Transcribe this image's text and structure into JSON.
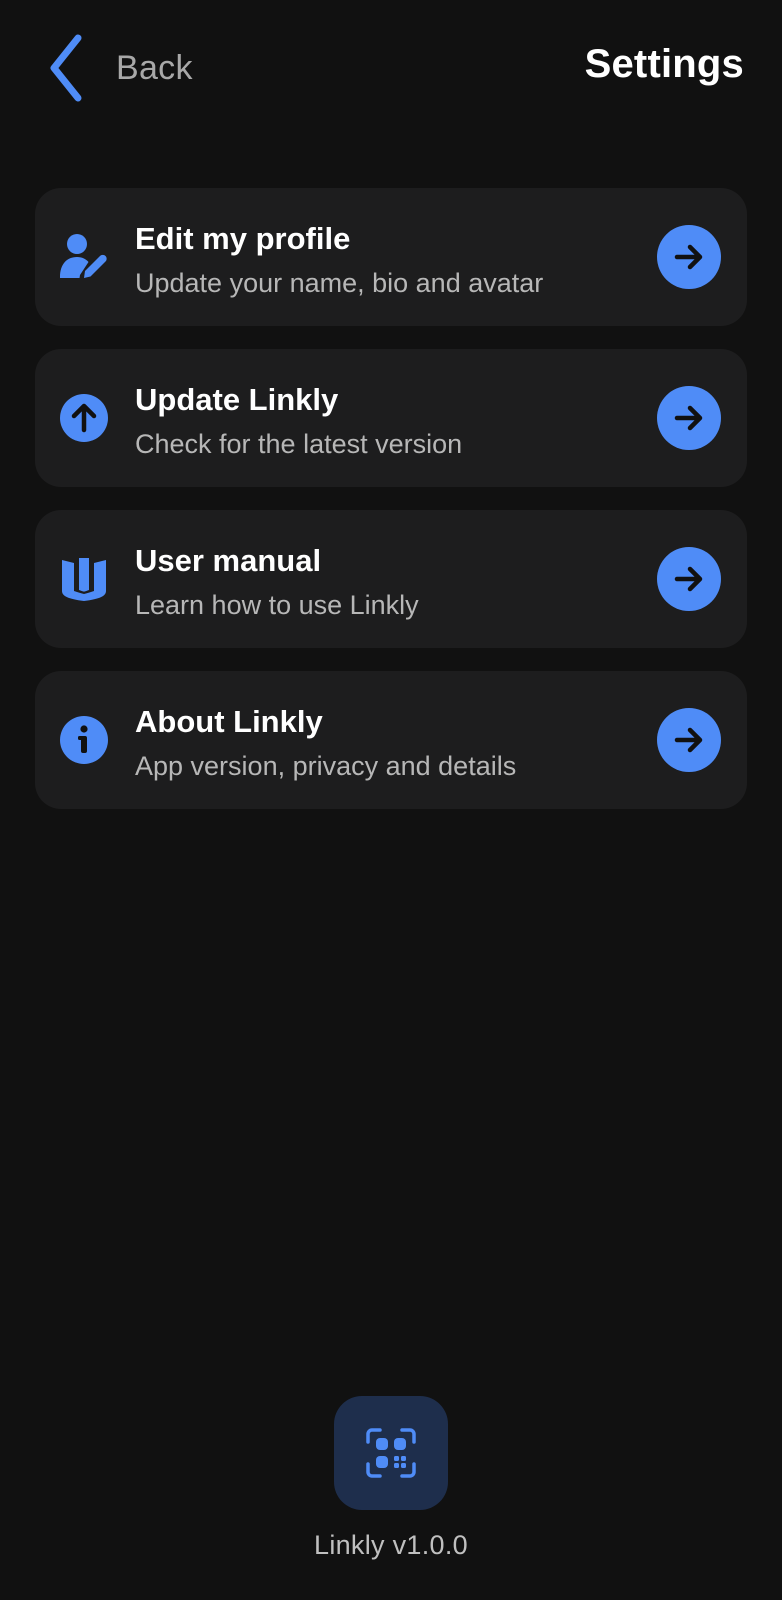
{
  "header": {
    "back_label": "Back",
    "title": "Settings"
  },
  "settings": {
    "items": [
      {
        "icon": "edit-profile-icon",
        "title": "Edit my profile",
        "subtitle": "Update your name, bio and avatar"
      },
      {
        "icon": "update-arrow-icon",
        "title": "Update Linkly",
        "subtitle": "Check for the latest version"
      },
      {
        "icon": "manual-book-icon",
        "title": "User manual",
        "subtitle": "Learn how to use Linkly"
      },
      {
        "icon": "info-icon",
        "title": "About Linkly",
        "subtitle": "App version, privacy and details"
      }
    ]
  },
  "footer": {
    "logo_icon": "qr-scan-icon",
    "version": "Linkly v1.0.0"
  },
  "colors": {
    "background": "#111111",
    "card": "#1d1d1e",
    "accent": "#4f8cf7",
    "logo_background": "#1e2e4c",
    "secondary_text": "#b7b7b7"
  }
}
